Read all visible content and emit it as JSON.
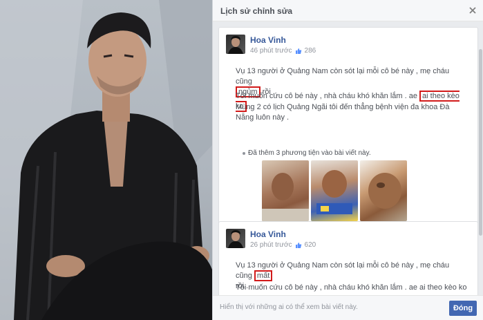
{
  "dialog": {
    "title": "Lịch sử chỉnh sửa",
    "footer_text": "Hiển thị với những ai có thể xem bài viết này.",
    "done_label": "Đóng"
  },
  "edits": [
    {
      "author": "Hoa Vinh",
      "time": "46 phút trước",
      "likes": "286",
      "line1a": "Vụ 13 người ở Quảng Nam còn sót lại mỗi cô bé này , mẹ cháu cũng",
      "line1_highlight": "ngủm",
      "line1b": "rồi .",
      "line2a": "Tôi muốn cứu cô bé này , nhà cháu khó khăn lắm . ae",
      "line2_highlight": "ai theo kèo ko",
      "line2b": ".",
      "line3": "Mùng 2 có lịch Quảng Ngãi tôi đến thẳng bệnh viện đa khoa Đà Nẵng luôn này .",
      "media_note": "Đã thêm 3 phương tiện vào bài viết này."
    },
    {
      "author": "Hoa Vinh",
      "time": "26 phút trước",
      "likes": "620",
      "line1a": "Vụ 13 người ở Quảng Nam còn sót lại mỗi cô bé này , mẹ cháu cũng",
      "line1_highlight": "mất",
      "line1b": "rồi .",
      "line2": "Tôi muốn cứu cô bé này , nhà cháu khó khăn lắm . ae ai theo kèo ko ."
    }
  ],
  "separator": "•••",
  "colors": {
    "highlight": "#d11a1a",
    "link": "#365899",
    "button": "#4267b2"
  }
}
